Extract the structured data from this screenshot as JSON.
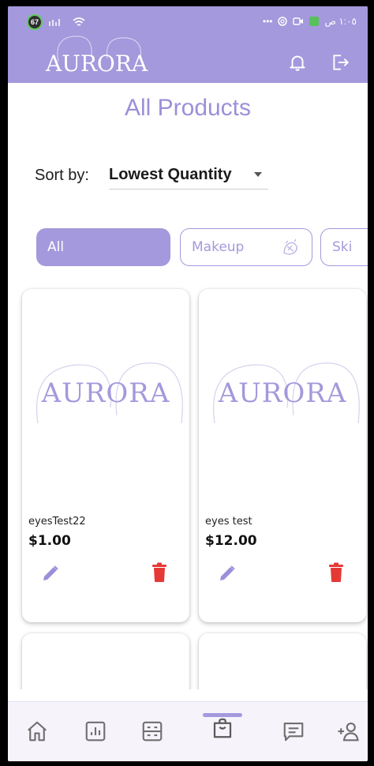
{
  "status_bar": {
    "battery_badge": "67",
    "right_text": "١:٠٥ ص",
    "dots": "•••"
  },
  "header": {
    "logo_text": "AURORA",
    "bell_icon": "bell-icon",
    "logout_icon": "logout-icon",
    "background": "#a399dc"
  },
  "page": {
    "title": "All Products"
  },
  "sort": {
    "label": "Sort by:",
    "selected": "Lowest Quantity"
  },
  "filters": [
    {
      "label": "All",
      "active": true
    },
    {
      "label": "Makeup",
      "active": false
    },
    {
      "label": "Ski",
      "active": false
    }
  ],
  "products": [
    {
      "image_text": "AURORA",
      "name": "eyesTest22",
      "price": "$1.00"
    },
    {
      "image_text": "AURORA",
      "name": "eyes test",
      "price": "$12.00"
    }
  ],
  "bottom_nav": [
    {
      "icon": "home-icon"
    },
    {
      "icon": "analytics-icon"
    },
    {
      "icon": "dashboard-icon"
    },
    {
      "icon": "shopping-bag-icon",
      "active": true
    },
    {
      "icon": "chat-icon"
    },
    {
      "icon": "add-user-icon"
    }
  ],
  "colors": {
    "accent": "#a399dc",
    "delete": "#e53935",
    "edit": "#9b8fd9"
  }
}
